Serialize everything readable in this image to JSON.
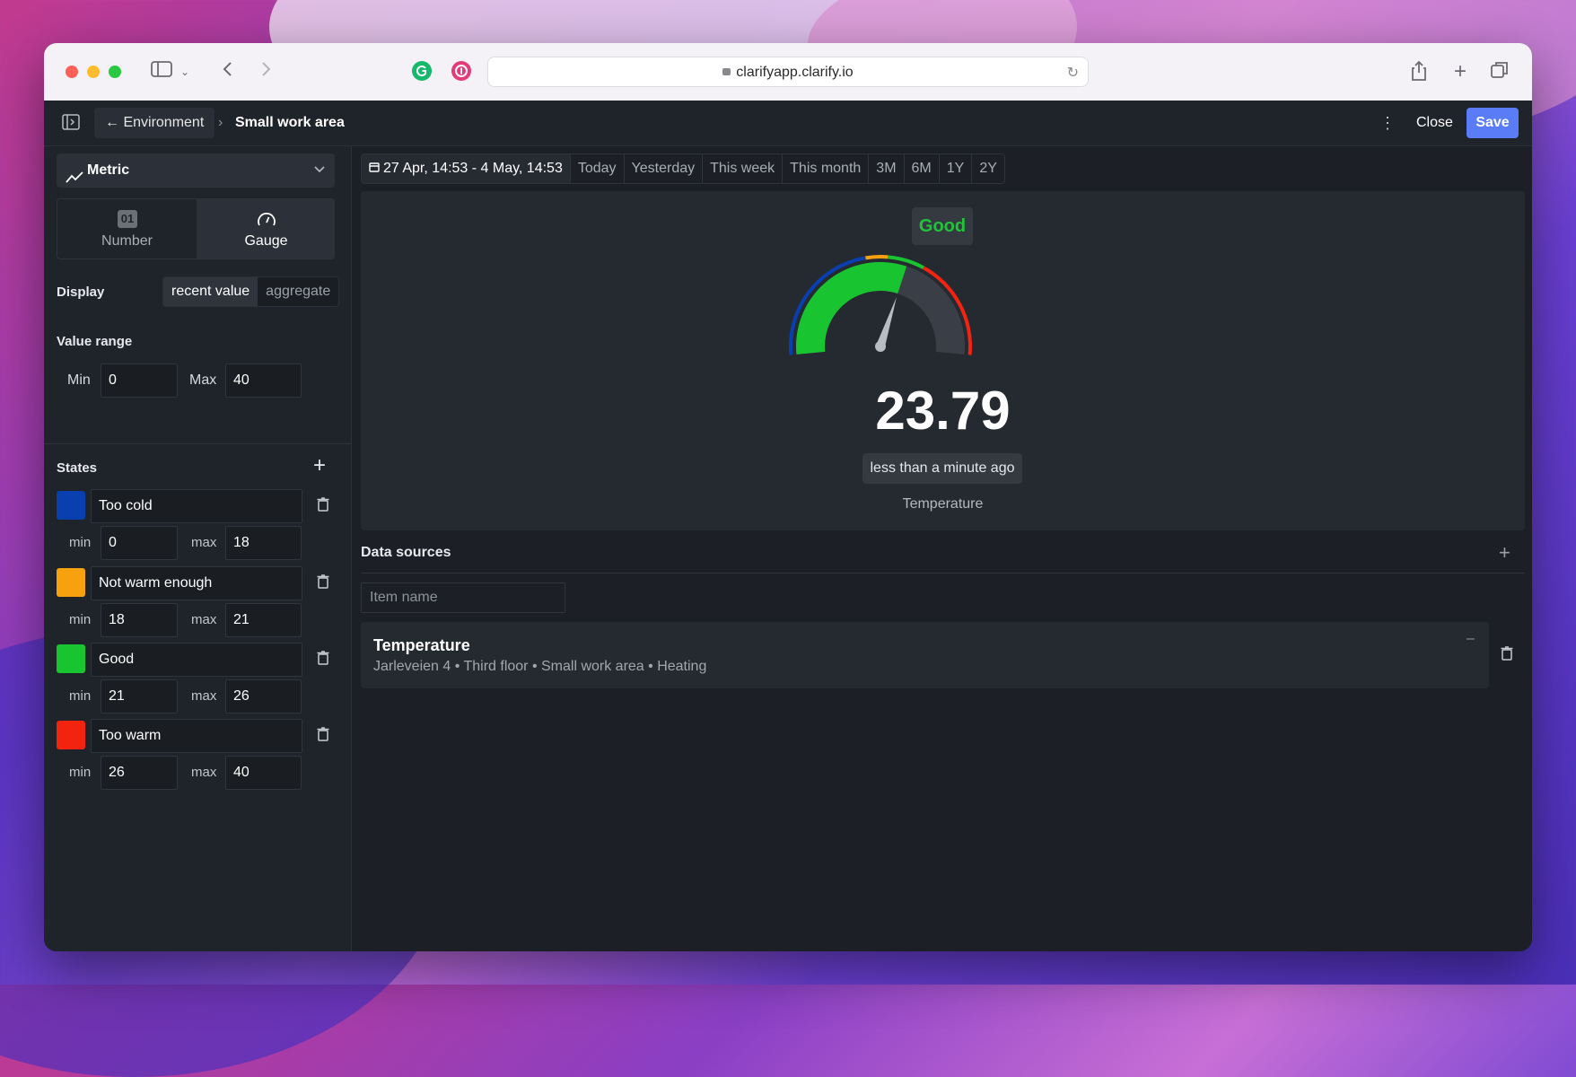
{
  "browser": {
    "url": "clarifyapp.clarify.io"
  },
  "header": {
    "back_label": "← Environment",
    "separator": "›",
    "title": "Small work area",
    "close_label": "Close",
    "save_label": "Save",
    "save_color": "#5b7cf7"
  },
  "sidebar": {
    "metric_label": "Metric",
    "viz_types": [
      {
        "label": "Number",
        "icon": "number-icon",
        "badge": "01",
        "selected": false
      },
      {
        "label": "Gauge",
        "icon": "gauge-icon",
        "selected": true
      }
    ],
    "display_label": "Display",
    "display_options": [
      {
        "label": "recent value",
        "selected": true
      },
      {
        "label": "aggregate",
        "selected": false
      }
    ],
    "value_range_label": "Value range",
    "min_label": "Min",
    "min_value": "0",
    "max_label": "Max",
    "max_value": "40",
    "states_label": "States",
    "states": [
      {
        "name": "Too cold",
        "color": "#0a3fb0",
        "min_label": "min",
        "min": "0",
        "max_label": "max",
        "max": "18"
      },
      {
        "name": "Not warm enough",
        "color": "#f8a10f",
        "min_label": "min",
        "min": "18",
        "max_label": "max",
        "max": "21"
      },
      {
        "name": "Good",
        "color": "#19c431",
        "min_label": "min",
        "min": "21",
        "max_label": "max",
        "max": "26"
      },
      {
        "name": "Too warm",
        "color": "#f3240f",
        "min_label": "min",
        "min": "26",
        "max_label": "max",
        "max": "40"
      }
    ]
  },
  "main": {
    "time_range": "27 Apr, 14:53 - 4 May, 14:53",
    "time_presets": [
      "Today",
      "Yesterday",
      "This week",
      "This month",
      "3M",
      "6M",
      "1Y",
      "2Y"
    ],
    "gauge": {
      "state_label": "Good",
      "state_color": "#22c33a",
      "value": "23.79",
      "numeric_value": 23.79,
      "min": 0,
      "max": 40,
      "timestamp": "less than a minute ago",
      "series_name": "Temperature"
    },
    "data_sources": {
      "title": "Data sources",
      "search_placeholder": "Item name",
      "items": [
        {
          "title": "Temperature",
          "subtitle": "Jarleveien 4 • Third floor • Small work area • Heating"
        }
      ]
    }
  }
}
